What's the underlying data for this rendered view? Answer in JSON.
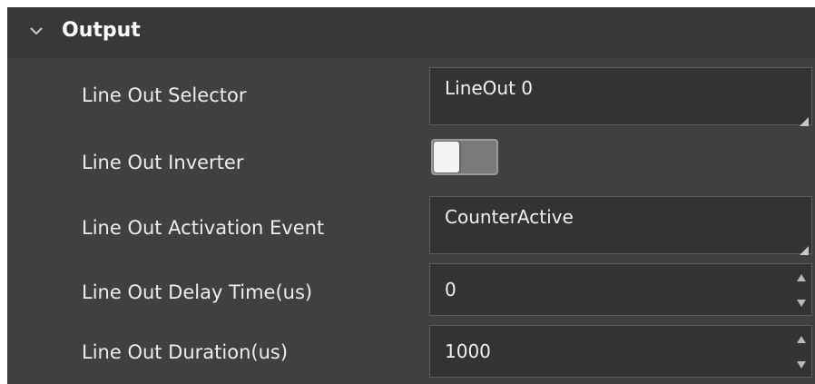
{
  "section": {
    "title": "Output",
    "icon": "chevron-down-icon"
  },
  "rows": [
    {
      "label": "Line Out Selector",
      "control": "dropdown",
      "value": "LineOut 0"
    },
    {
      "label": "Line Out Inverter",
      "control": "toggle",
      "value": "off"
    },
    {
      "label": "Line Out Activation Event",
      "control": "dropdown",
      "value": "CounterActive"
    },
    {
      "label": "Line Out Delay Time(us)",
      "control": "spinbox",
      "value": "0"
    },
    {
      "label": "Line Out Duration(us)",
      "control": "spinbox",
      "value": "1000"
    }
  ],
  "colors": {
    "panel_bg": "#404040",
    "header_bg": "#383838",
    "field_bg": "#333333",
    "text": "#ededed"
  }
}
